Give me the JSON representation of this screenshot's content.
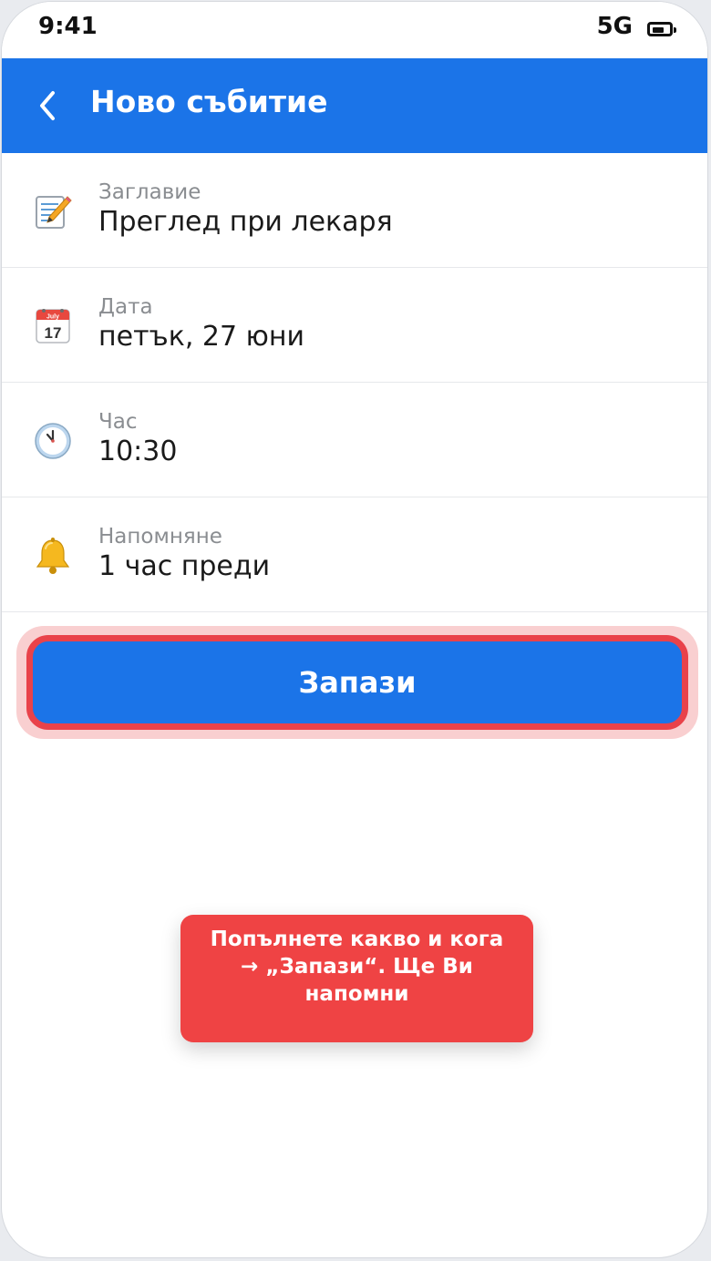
{
  "status_bar": {
    "time": "9:41",
    "network": "5G",
    "battery_icon": "battery-icon"
  },
  "app_bar": {
    "back_icon": "chevron-left-icon",
    "title": "Ново събитие"
  },
  "form": {
    "rows": [
      {
        "icon": "memo-icon",
        "label": "Заглавие",
        "value": "Преглед при лекаря"
      },
      {
        "icon": "calendar-icon",
        "label": "Дата",
        "value": "петък, 27 юни"
      },
      {
        "icon": "clock-icon",
        "label": "Час",
        "value": "10:30"
      },
      {
        "icon": "bell-icon",
        "label": "Напомняне",
        "value": "1 час преди"
      }
    ]
  },
  "calendar_icon_text": {
    "month": "July",
    "day": "17"
  },
  "save_button": {
    "label": "Запази"
  },
  "tooltip": {
    "text": "Попълнете какво и кога → „Запази“. Ще Ви напомни"
  },
  "colors": {
    "primary": "#1b74e8",
    "highlight": "#e9424a",
    "tooltip": "#ef4344"
  }
}
